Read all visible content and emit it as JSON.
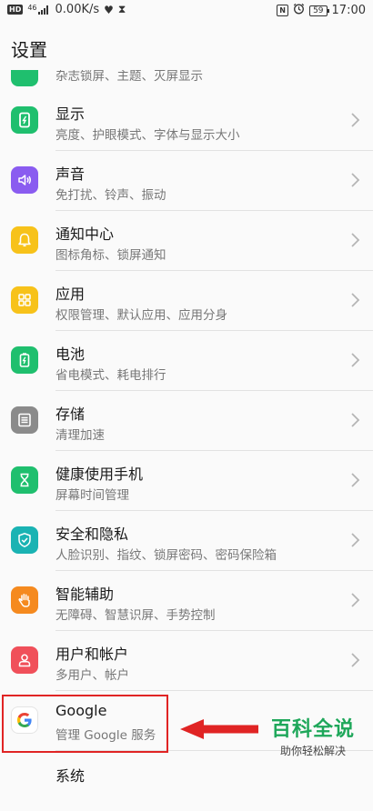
{
  "status_bar": {
    "network_badge": "HD",
    "signal_text": "46",
    "speed": "0.00K/s",
    "battery": "59",
    "time": "17:00"
  },
  "header": {
    "title": "设置"
  },
  "rows": [
    {
      "title": "",
      "subtitle": "杂志锁屏、主题、灭屏显示",
      "icon": "home-screen-icon",
      "color": "#1fbf6e"
    },
    {
      "title": "显示",
      "subtitle": "亮度、护眼模式、字体与显示大小",
      "icon": "display-icon",
      "color": "#1fbf6e"
    },
    {
      "title": "声音",
      "subtitle": "免打扰、铃声、振动",
      "icon": "sound-icon",
      "color": "#8a5cf0"
    },
    {
      "title": "通知中心",
      "subtitle": "图标角标、锁屏通知",
      "icon": "notification-bell-icon",
      "color": "#f7c21a"
    },
    {
      "title": "应用",
      "subtitle": "权限管理、默认应用、应用分身",
      "icon": "apps-grid-icon",
      "color": "#f7c21a"
    },
    {
      "title": "电池",
      "subtitle": "省电模式、耗电排行",
      "icon": "battery-icon",
      "color": "#1fbf6e"
    },
    {
      "title": "存储",
      "subtitle": "清理加速",
      "icon": "storage-icon",
      "color": "#8b8b8b"
    },
    {
      "title": "健康使用手机",
      "subtitle": "屏幕时间管理",
      "icon": "hourglass-icon",
      "color": "#1fbf6e"
    },
    {
      "title": "安全和隐私",
      "subtitle": "人脸识别、指纹、锁屏密码、密码保险箱",
      "icon": "shield-icon",
      "color": "#1ab3b3"
    },
    {
      "title": "智能辅助",
      "subtitle": "无障碍、智慧识屏、手势控制",
      "icon": "hand-icon",
      "color": "#f58a1f"
    },
    {
      "title": "用户和帐户",
      "subtitle": "多用户、帐户",
      "icon": "user-icon",
      "color": "#f0505a"
    },
    {
      "title": "Google",
      "subtitle": "管理 Google 服务",
      "icon": "google-logo-icon",
      "color": "#ffffff"
    },
    {
      "title": "系统",
      "subtitle": "",
      "icon": "system-icon",
      "color": "#8b8b8b"
    }
  ],
  "annotation": {
    "watermark_title": "百科全说",
    "watermark_subtitle": "助你轻松解决",
    "highlight_color": "#e02424"
  }
}
